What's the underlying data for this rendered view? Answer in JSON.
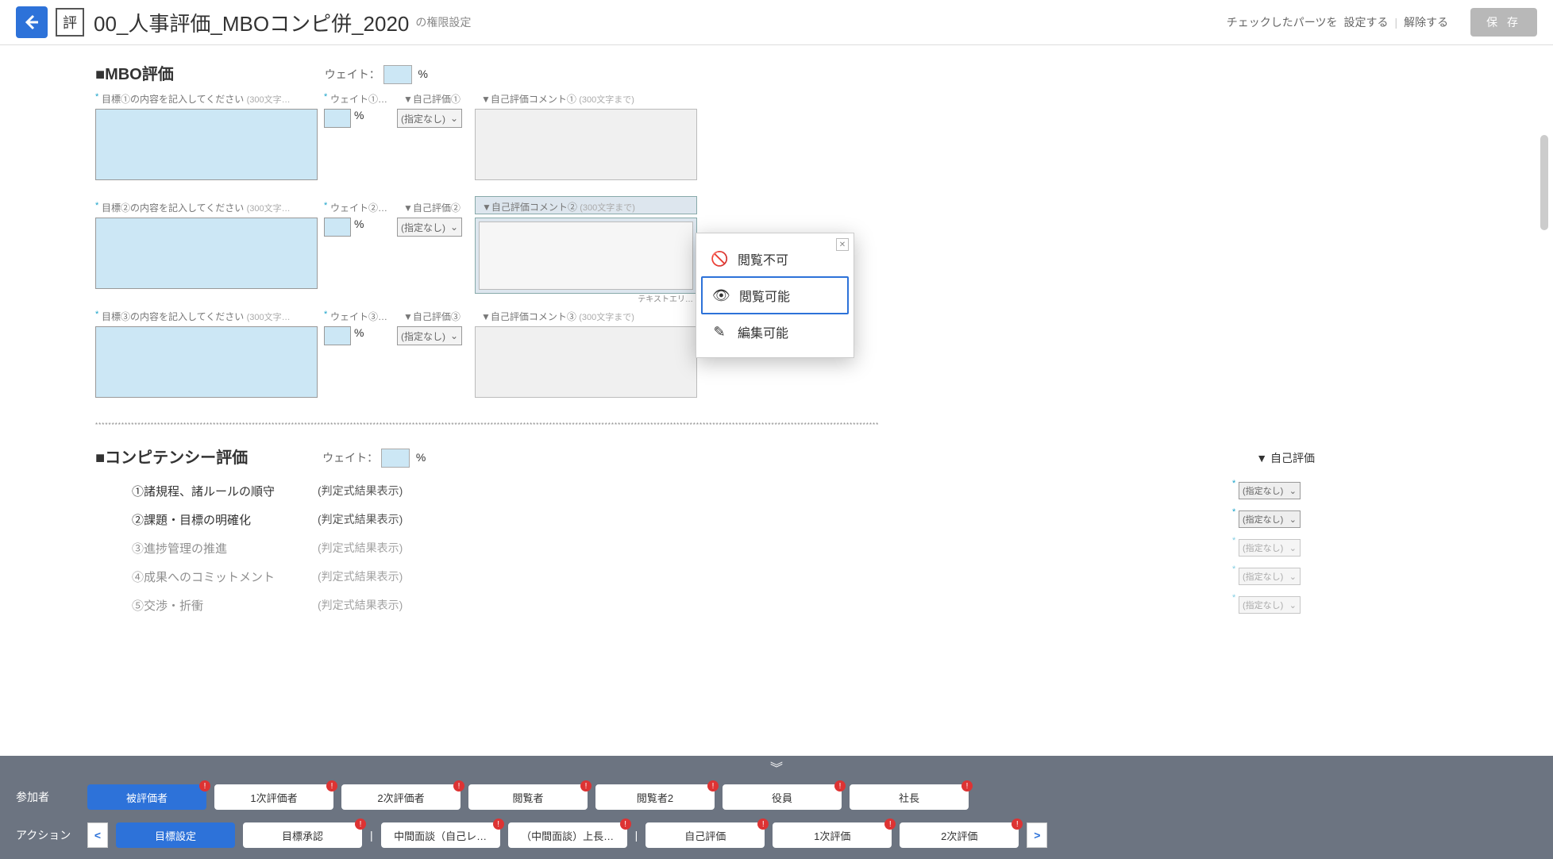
{
  "header": {
    "icon_badge": "評",
    "title": "00_人事評価_MBOコンピ併_2020",
    "subtitle": "の権限設定",
    "checked_parts_label": "チェックしたパーツを",
    "set_link": "設定する",
    "release_link": "解除する",
    "save_btn": "保 存"
  },
  "mbo": {
    "title": "■MBO評価",
    "weight_label": "ウェイト：",
    "pct": "%",
    "rows": [
      {
        "goal_label": "目標①の内容を記入してください",
        "goal_hint": "(300文字…",
        "weight_label": "ウェイト①…",
        "self_label": "▼自己評価①",
        "comment_label": "▼自己評価コメント①",
        "comment_hint": "(300文字まで)",
        "select": "(指定なし)"
      },
      {
        "goal_label": "目標②の内容を記入してください",
        "goal_hint": "(300文字…",
        "weight_label": "ウェイト②…",
        "self_label": "▼自己評価②",
        "comment_label": "▼自己評価コメント②",
        "comment_hint": "(300文字まで)",
        "select": "(指定なし)",
        "caption": "テキストエリ…"
      },
      {
        "goal_label": "目標③の内容を記入してください",
        "goal_hint": "(300文字…",
        "weight_label": "ウェイト③…",
        "self_label": "▼自己評価③",
        "comment_label": "▼自己評価コメント③",
        "comment_hint": "(300文字まで)",
        "select": "(指定なし)"
      }
    ]
  },
  "popover": {
    "opt1": "閲覧不可",
    "opt2": "閲覧可能",
    "opt3": "編集可能"
  },
  "comp": {
    "title": "■コンピテンシー評価",
    "weight_label": "ウェイト：",
    "right_col": "▼ 自己評価",
    "items": [
      {
        "t": "①諸規程、諸ルールの順守",
        "d": "(判定式結果表示)",
        "sel": "(指定なし)"
      },
      {
        "t": "②課題・目標の明確化",
        "d": "(判定式結果表示)",
        "sel": "(指定なし)"
      },
      {
        "t": "③進捗管理の推進",
        "d": "(判定式結果表示)",
        "sel": "(指定なし)"
      },
      {
        "t": "④成果へのコミットメント",
        "d": "(判定式結果表示)",
        "sel": "(指定なし)"
      },
      {
        "t": "⑤交渉・折衝",
        "d": "(判定式結果表示)",
        "sel": "(指定なし)"
      }
    ]
  },
  "bottom": {
    "chevron": "︾",
    "participants_label": "参加者",
    "participants": [
      {
        "t": "被評価者",
        "active": true,
        "warn": true
      },
      {
        "t": "1次評価者",
        "warn": true
      },
      {
        "t": "2次評価者",
        "warn": true
      },
      {
        "t": "閲覧者",
        "warn": true
      },
      {
        "t": "閲覧者2",
        "warn": true
      },
      {
        "t": "役員",
        "warn": true
      },
      {
        "t": "社長",
        "warn": true
      }
    ],
    "actions_label": "アクション",
    "actions": [
      {
        "t": "目標設定",
        "active": true
      },
      {
        "t": "目標承認",
        "warn": true
      },
      {
        "t": "中間面談（自己レ…",
        "warn": true
      },
      {
        "t": "（中間面談）上長…",
        "warn": true
      },
      {
        "t": "自己評価",
        "warn": true
      },
      {
        "t": "1次評価",
        "warn": true
      },
      {
        "t": "2次評価",
        "warn": true
      }
    ],
    "nav_prev": "<",
    "nav_next": ">"
  }
}
